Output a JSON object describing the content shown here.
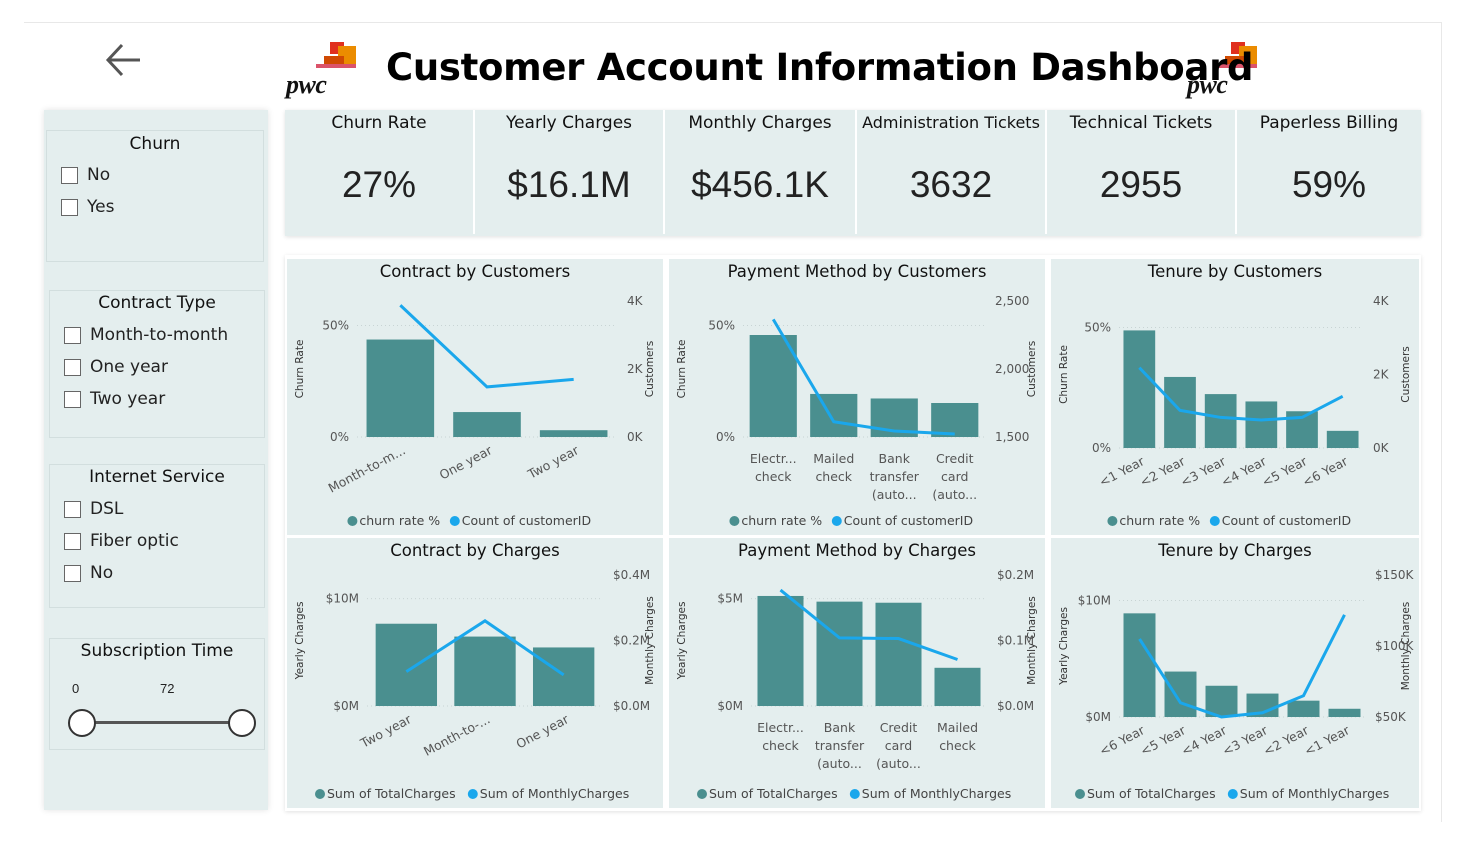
{
  "title": "Customer Account Information Dashboard",
  "logo_text": "pwc",
  "colors": {
    "bar": "#4a8f8f",
    "line": "#1aa7ec",
    "panel": "#e4eeee",
    "background": "#ffffff"
  },
  "back_icon": "arrow-left-icon",
  "filters": {
    "churn": {
      "title": "Churn",
      "options": [
        "No",
        "Yes"
      ]
    },
    "contract": {
      "title": "Contract Type",
      "options": [
        "Month-to-month",
        "One year",
        "Two year"
      ]
    },
    "internet": {
      "title": "Internet Service",
      "options": [
        "DSL",
        "Fiber optic",
        "No"
      ]
    },
    "subscription": {
      "title": "Subscription Time",
      "min": "0",
      "max": "72"
    }
  },
  "kpis": [
    {
      "label": "Churn Rate",
      "value": "27%"
    },
    {
      "label": "Yearly Charges",
      "value": "$16.1M"
    },
    {
      "label": "Monthly Charges",
      "value": "$456.1K"
    },
    {
      "label": "Administration Tickets",
      "value": "3632"
    },
    {
      "label": "Technical Tickets",
      "value": "2955"
    },
    {
      "label": "Paperless Billing",
      "value": "59%"
    }
  ],
  "chart_data": [
    {
      "type": "bar",
      "title": "Contract by Customers",
      "ylabel": "Churn Rate",
      "y2label": "Customers",
      "categories": [
        "Month-to-m...",
        "One year",
        "Two year"
      ],
      "yticks": [
        "50%",
        "0%"
      ],
      "y2ticks": [
        "4K",
        "2K",
        "0K"
      ],
      "ylim": [
        0,
        0.6
      ],
      "y2lim": [
        0,
        4000
      ],
      "legend_placement": "bottom",
      "series": [
        {
          "name": "churn rate %",
          "kind": "bar",
          "values": [
            0.43,
            0.11,
            0.03
          ]
        },
        {
          "name": "Count of customerID",
          "kind": "line",
          "values": [
            3875,
            1473,
            1695
          ]
        }
      ]
    },
    {
      "type": "bar",
      "title": "Payment Method by Customers",
      "ylabel": "Churn Rate",
      "y2label": "Customers",
      "categories": [
        "Electr... check",
        "Mailed check",
        "Bank transfer (auto...",
        "Credit card (auto..."
      ],
      "yticks": [
        "50%",
        "0%"
      ],
      "y2ticks": [
        "2,500",
        "2,000",
        "1,500"
      ],
      "ylim": [
        0,
        0.6
      ],
      "y2lim": [
        1500,
        2500
      ],
      "legend_placement": "bottom",
      "series": [
        {
          "name": "churn rate %",
          "kind": "bar",
          "values": [
            0.45,
            0.19,
            0.17,
            0.15
          ]
        },
        {
          "name": "Count of customerID",
          "kind": "line",
          "values": [
            2365,
            1612,
            1544,
            1522
          ]
        }
      ]
    },
    {
      "type": "bar",
      "title": "Tenure by Customers",
      "ylabel": "Churn Rate",
      "y2label": "Customers",
      "categories": [
        "<1 Year",
        "<2 Year",
        "<3 Year",
        "<4 Year",
        "<5 Year",
        "<6 Year"
      ],
      "yticks": [
        "50%",
        "0%"
      ],
      "y2ticks": [
        "4K",
        "2K",
        "0K"
      ],
      "ylim": [
        0,
        0.6
      ],
      "y2lim": [
        0,
        4000
      ],
      "legend_placement": "bottom",
      "series": [
        {
          "name": "churn rate %",
          "kind": "bar",
          "values": [
            0.48,
            0.29,
            0.22,
            0.19,
            0.15,
            0.07
          ]
        },
        {
          "name": "Count of customerID",
          "kind": "line",
          "values": [
            2186,
            1024,
            832,
            762,
            832,
            1407
          ]
        }
      ]
    },
    {
      "type": "bar",
      "title": "Contract by Charges",
      "ylabel": "Yearly Charges",
      "y2label": "Monthly Charges",
      "categories": [
        "Two year",
        "Month-to-...",
        "One year"
      ],
      "yticks": [
        "$10M",
        "$0M"
      ],
      "y2ticks": [
        "$0.4M",
        "$0.2M",
        "$0.0M"
      ],
      "ylim": [
        0,
        10000000
      ],
      "y2lim": [
        0,
        400000
      ],
      "legend_placement": "bottom",
      "series": [
        {
          "name": "Sum of TotalCharges",
          "kind": "bar",
          "values": [
            6280000,
            5300000,
            4470000
          ]
        },
        {
          "name": "Sum of MonthlyCharges",
          "kind": "line",
          "values": [
            105000,
            260000,
            95000
          ]
        }
      ]
    },
    {
      "type": "bar",
      "title": "Payment Method by Charges",
      "ylabel": "Yearly Charges",
      "y2label": "Monthly Charges",
      "categories": [
        "Electr... check",
        "Bank transfer (auto...",
        "Credit card (auto...",
        "Mailed check"
      ],
      "yticks": [
        "$5M",
        "$0M"
      ],
      "y2ticks": [
        "$0.2M",
        "$0.1M",
        "$0.0M"
      ],
      "ylim": [
        0,
        6000000
      ],
      "y2lim": [
        0,
        200000
      ],
      "legend_placement": "bottom",
      "series": [
        {
          "name": "Sum of TotalCharges",
          "kind": "bar",
          "values": [
            5040000,
            4780000,
            4730000,
            1750000
          ]
        },
        {
          "name": "Sum of MonthlyCharges",
          "kind": "line",
          "values": [
            177000,
            104000,
            103000,
            71000
          ]
        }
      ]
    },
    {
      "type": "bar",
      "title": "Tenure by Charges",
      "ylabel": "Yearly Charges",
      "y2label": "Monthly Charges",
      "categories": [
        "<6 Year",
        "<5 Year",
        "<4 Year",
        "<3 Year",
        "<2 Year",
        "<1 Year"
      ],
      "yticks": [
        "$10M",
        "$0M"
      ],
      "y2ticks": [
        "$150K",
        "$100K",
        "$50K"
      ],
      "ylim": [
        0,
        10000000
      ],
      "y2lim": [
        50000,
        150000
      ],
      "legend_placement": "bottom",
      "series": [
        {
          "name": "Sum of TotalCharges",
          "kind": "bar",
          "values": [
            7300000,
            3200000,
            2200000,
            1650000,
            1150000,
            580000
          ]
        },
        {
          "name": "Sum of MonthlyCharges",
          "kind": "line",
          "values": [
            105000,
            60000,
            50000,
            53000,
            65000,
            122000
          ]
        }
      ]
    }
  ]
}
